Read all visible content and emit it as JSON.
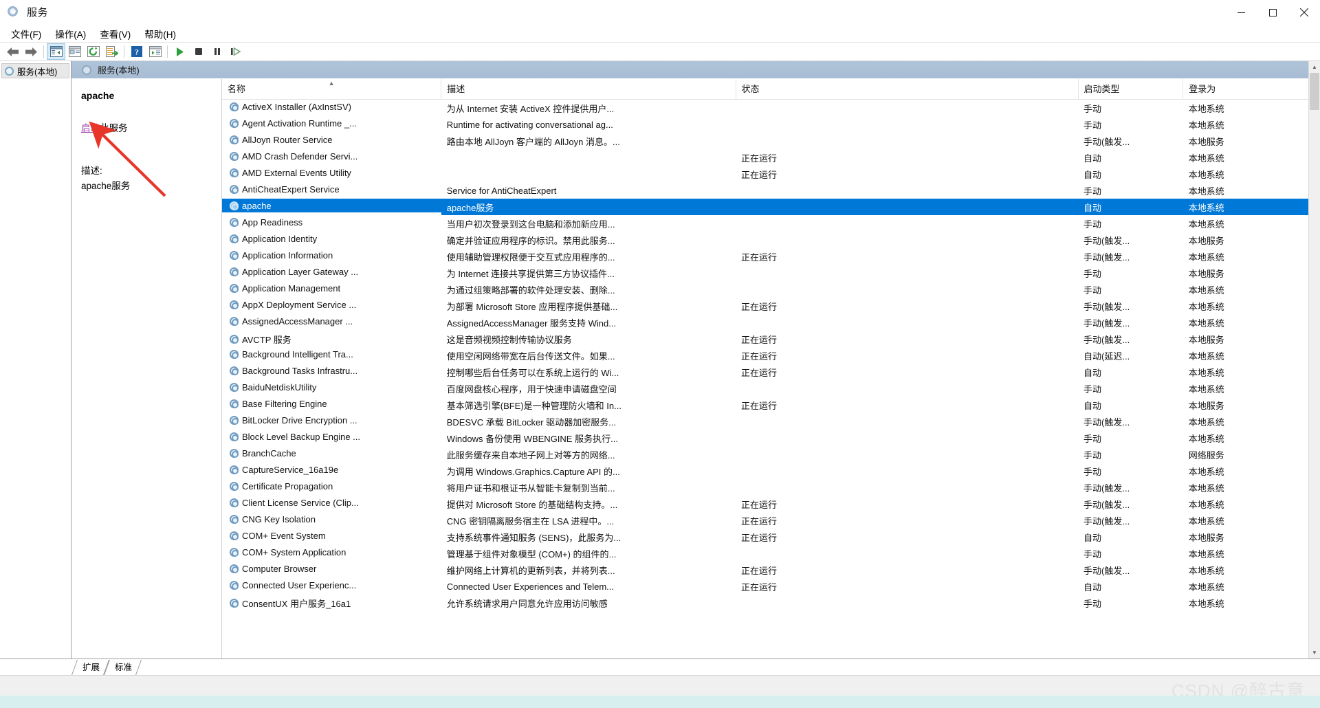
{
  "window": {
    "title": "服务",
    "icon": "services-gear-icon",
    "minimize_label": "最小化",
    "maximize_label": "最大化",
    "close_label": "关闭"
  },
  "menubar": {
    "items": [
      {
        "label": "文件(F)",
        "name": "menu-file"
      },
      {
        "label": "操作(A)",
        "name": "menu-action"
      },
      {
        "label": "查看(V)",
        "name": "menu-view"
      },
      {
        "label": "帮助(H)",
        "name": "menu-help"
      }
    ]
  },
  "toolbar": {
    "buttons": [
      {
        "name": "back-icon",
        "glyph": "back"
      },
      {
        "name": "forward-icon",
        "glyph": "forward"
      },
      {
        "name": "show-hide-tree-icon",
        "glyph": "pane"
      },
      {
        "name": "properties-icon",
        "glyph": "props"
      },
      {
        "name": "refresh-icon",
        "glyph": "refresh"
      },
      {
        "name": "export-list-icon",
        "glyph": "export"
      },
      {
        "name": "help-icon",
        "glyph": "help"
      },
      {
        "name": "show-action-pane-icon",
        "glyph": "actionpane"
      },
      {
        "name": "start-service-icon",
        "glyph": "play"
      },
      {
        "name": "stop-service-icon",
        "glyph": "stop"
      },
      {
        "name": "pause-service-icon",
        "glyph": "pause"
      },
      {
        "name": "restart-service-icon",
        "glyph": "restart"
      }
    ]
  },
  "tree": {
    "root_label": "服务(本地)"
  },
  "pane_header": {
    "label": "服务(本地)"
  },
  "details": {
    "service_name": "apache",
    "action_link": "启动",
    "action_suffix": "此服务",
    "description_label": "描述:",
    "description_body": "apache服务"
  },
  "list": {
    "columns": [
      {
        "key": "name",
        "label": "名称",
        "sorted": true
      },
      {
        "key": "desc",
        "label": "描述",
        "sorted": false
      },
      {
        "key": "status",
        "label": "状态",
        "sorted": false
      },
      {
        "key": "type",
        "label": "启动类型",
        "sorted": false
      },
      {
        "key": "logon",
        "label": "登录为",
        "sorted": false
      }
    ],
    "rows": [
      {
        "name": "ActiveX Installer (AxInstSV)",
        "desc": "为从 Internet 安装 ActiveX 控件提供用户...",
        "status": "",
        "type": "手动",
        "logon": "本地系统",
        "selected": false
      },
      {
        "name": "Agent Activation Runtime _...",
        "desc": "Runtime for activating conversational ag...",
        "status": "",
        "type": "手动",
        "logon": "本地系统",
        "selected": false
      },
      {
        "name": "AllJoyn Router Service",
        "desc": "路由本地 AllJoyn 客户端的 AllJoyn 消息。...",
        "status": "",
        "type": "手动(触发...",
        "logon": "本地服务",
        "selected": false
      },
      {
        "name": "AMD Crash Defender Servi...",
        "desc": "",
        "status": "正在运行",
        "type": "自动",
        "logon": "本地系统",
        "selected": false
      },
      {
        "name": "AMD External Events Utility",
        "desc": "",
        "status": "正在运行",
        "type": "自动",
        "logon": "本地系统",
        "selected": false
      },
      {
        "name": "AntiCheatExpert Service",
        "desc": "Service for AntiCheatExpert",
        "status": "",
        "type": "手动",
        "logon": "本地系统",
        "selected": false
      },
      {
        "name": "apache",
        "desc": "apache服务",
        "status": "",
        "type": "自动",
        "logon": "本地系统",
        "selected": true
      },
      {
        "name": "App Readiness",
        "desc": "当用户初次登录到这台电脑和添加新应用...",
        "status": "",
        "type": "手动",
        "logon": "本地系统",
        "selected": false
      },
      {
        "name": "Application Identity",
        "desc": "确定并验证应用程序的标识。禁用此服务...",
        "status": "",
        "type": "手动(触发...",
        "logon": "本地服务",
        "selected": false
      },
      {
        "name": "Application Information",
        "desc": "使用辅助管理权限便于交互式应用程序的...",
        "status": "正在运行",
        "type": "手动(触发...",
        "logon": "本地系统",
        "selected": false
      },
      {
        "name": "Application Layer Gateway ...",
        "desc": "为 Internet 连接共享提供第三方协议插件...",
        "status": "",
        "type": "手动",
        "logon": "本地服务",
        "selected": false
      },
      {
        "name": "Application Management",
        "desc": "为通过组策略部署的软件处理安装、删除...",
        "status": "",
        "type": "手动",
        "logon": "本地系统",
        "selected": false
      },
      {
        "name": "AppX Deployment Service ...",
        "desc": "为部署 Microsoft Store 应用程序提供基础...",
        "status": "正在运行",
        "type": "手动(触发...",
        "logon": "本地系统",
        "selected": false
      },
      {
        "name": "AssignedAccessManager ...",
        "desc": "AssignedAccessManager 服务支持 Wind...",
        "status": "",
        "type": "手动(触发...",
        "logon": "本地系统",
        "selected": false
      },
      {
        "name": "AVCTP 服务",
        "desc": "这是音频视频控制传输协议服务",
        "status": "正在运行",
        "type": "手动(触发...",
        "logon": "本地服务",
        "selected": false
      },
      {
        "name": "Background Intelligent Tra...",
        "desc": "使用空闲网络带宽在后台传送文件。如果...",
        "status": "正在运行",
        "type": "自动(延迟...",
        "logon": "本地系统",
        "selected": false
      },
      {
        "name": "Background Tasks Infrastru...",
        "desc": "控制哪些后台任务可以在系统上运行的 Wi...",
        "status": "正在运行",
        "type": "自动",
        "logon": "本地系统",
        "selected": false
      },
      {
        "name": "BaiduNetdiskUtility",
        "desc": "百度网盘核心程序，用于快速申请磁盘空间",
        "status": "",
        "type": "手动",
        "logon": "本地系统",
        "selected": false
      },
      {
        "name": "Base Filtering Engine",
        "desc": "基本筛选引擎(BFE)是一种管理防火墙和 In...",
        "status": "正在运行",
        "type": "自动",
        "logon": "本地服务",
        "selected": false
      },
      {
        "name": "BitLocker Drive Encryption ...",
        "desc": "BDESVC 承载 BitLocker 驱动器加密服务...",
        "status": "",
        "type": "手动(触发...",
        "logon": "本地系统",
        "selected": false
      },
      {
        "name": "Block Level Backup Engine ...",
        "desc": "Windows 备份使用 WBENGINE 服务执行...",
        "status": "",
        "type": "手动",
        "logon": "本地系统",
        "selected": false
      },
      {
        "name": "BranchCache",
        "desc": "此服务缓存来自本地子网上对等方的网络...",
        "status": "",
        "type": "手动",
        "logon": "网络服务",
        "selected": false
      },
      {
        "name": "CaptureService_16a19e",
        "desc": "为调用 Windows.Graphics.Capture API 的...",
        "status": "",
        "type": "手动",
        "logon": "本地系统",
        "selected": false
      },
      {
        "name": "Certificate Propagation",
        "desc": "将用户证书和根证书从智能卡复制到当前...",
        "status": "",
        "type": "手动(触发...",
        "logon": "本地系统",
        "selected": false
      },
      {
        "name": "Client License Service (Clip...",
        "desc": "提供对 Microsoft Store 的基础结构支持。...",
        "status": "正在运行",
        "type": "手动(触发...",
        "logon": "本地系统",
        "selected": false
      },
      {
        "name": "CNG Key Isolation",
        "desc": "CNG 密钥隔离服务宿主在 LSA 进程中。...",
        "status": "正在运行",
        "type": "手动(触发...",
        "logon": "本地系统",
        "selected": false
      },
      {
        "name": "COM+ Event System",
        "desc": "支持系统事件通知服务 (SENS)，此服务为...",
        "status": "正在运行",
        "type": "自动",
        "logon": "本地服务",
        "selected": false
      },
      {
        "name": "COM+ System Application",
        "desc": "管理基于组件对象模型 (COM+) 的组件的...",
        "status": "",
        "type": "手动",
        "logon": "本地系统",
        "selected": false
      },
      {
        "name": "Computer Browser",
        "desc": "维护网络上计算机的更新列表，并将列表...",
        "status": "正在运行",
        "type": "手动(触发...",
        "logon": "本地系统",
        "selected": false
      },
      {
        "name": "Connected User Experienc...",
        "desc": "Connected User Experiences and Telem...",
        "status": "正在运行",
        "type": "自动",
        "logon": "本地系统",
        "selected": false
      },
      {
        "name": "ConsentUX 用户服务_16a1",
        "desc": "允许系统请求用户同意允许应用访问敏感",
        "status": "",
        "type": "手动",
        "logon": "本地系统",
        "selected": false
      }
    ]
  },
  "tabs": [
    {
      "label": "扩展",
      "name": "tab-extended"
    },
    {
      "label": "标准",
      "name": "tab-standard"
    }
  ],
  "watermark": {
    "text": "CSDN @醉古意"
  },
  "colors": {
    "selection": "#0078d7",
    "header_band": "#a7bcd3",
    "link": "#9b3fa8",
    "arrow": "#e8352a"
  }
}
